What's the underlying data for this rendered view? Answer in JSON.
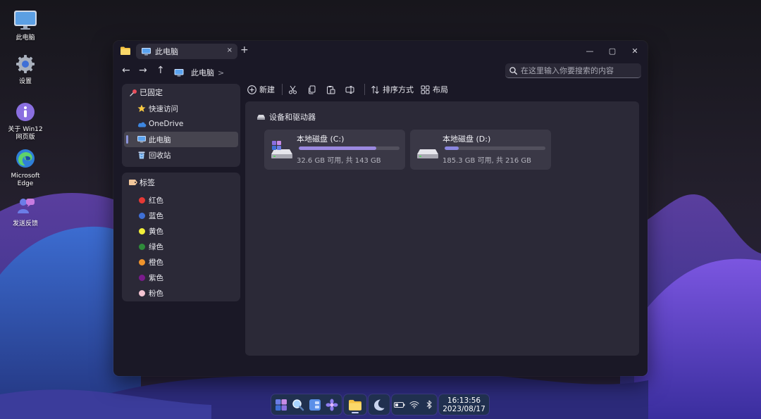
{
  "desktop": {
    "icons": [
      {
        "label": "此电脑",
        "icon": "monitor-icon"
      },
      {
        "label": "设置",
        "icon": "gear-icon"
      },
      {
        "label": "关于 Win12\n网页版",
        "icon": "info-icon"
      },
      {
        "label": "Microsoft\nEdge",
        "icon": "edge-icon"
      },
      {
        "label": "发送反馈",
        "icon": "feedback-icon"
      }
    ]
  },
  "window": {
    "tab_title": "此电脑",
    "tab_close": "×",
    "new_tab": "+",
    "controls": {
      "minimize": "—",
      "maximize": "▢",
      "close": "✕"
    },
    "nav": {
      "back": "←",
      "forward": "→",
      "up": "↑"
    },
    "breadcrumb": {
      "label": "此电脑",
      "separator": ">"
    },
    "search": {
      "placeholder": "在这里输入你要搜索的内容",
      "value": ""
    }
  },
  "sidebar": {
    "pinned_header": "已固定",
    "pinned": [
      {
        "label": "快速访问",
        "icon": "star-icon"
      },
      {
        "label": "OneDrive",
        "icon": "cloud-icon"
      },
      {
        "label": "此电脑",
        "icon": "monitor-icon",
        "active": true
      },
      {
        "label": "回收站",
        "icon": "recycle-bin-icon"
      }
    ],
    "tags_header": "标签",
    "tags": [
      {
        "label": "红色",
        "color": "#e53935"
      },
      {
        "label": "蓝色",
        "color": "#3f6fd6"
      },
      {
        "label": "黄色",
        "color": "#f2ef3a"
      },
      {
        "label": "绿色",
        "color": "#2e8b3a"
      },
      {
        "label": "橙色",
        "color": "#f0942c"
      },
      {
        "label": "紫色",
        "color": "#7a1b8c"
      },
      {
        "label": "粉色",
        "color": "#f4c4d2"
      }
    ]
  },
  "toolbar": {
    "new_label": "新建",
    "sort_label": "排序方式",
    "layout_label": "布局"
  },
  "content": {
    "section_title": "设备和驱动器",
    "drives": [
      {
        "name": "本地磁盘 (C:)",
        "info": "32.6 GB 可用, 共 143 GB",
        "used_fraction": 0.77,
        "bar_color": "#9b89e0"
      },
      {
        "name": "本地磁盘 (D:)",
        "info": "185.3 GB 可用, 共 216 GB",
        "used_fraction": 0.14,
        "bar_color": "#8a86e0"
      }
    ]
  },
  "taskbar": {
    "clock_time": "16:13:56",
    "clock_date": "2023/08/17"
  }
}
